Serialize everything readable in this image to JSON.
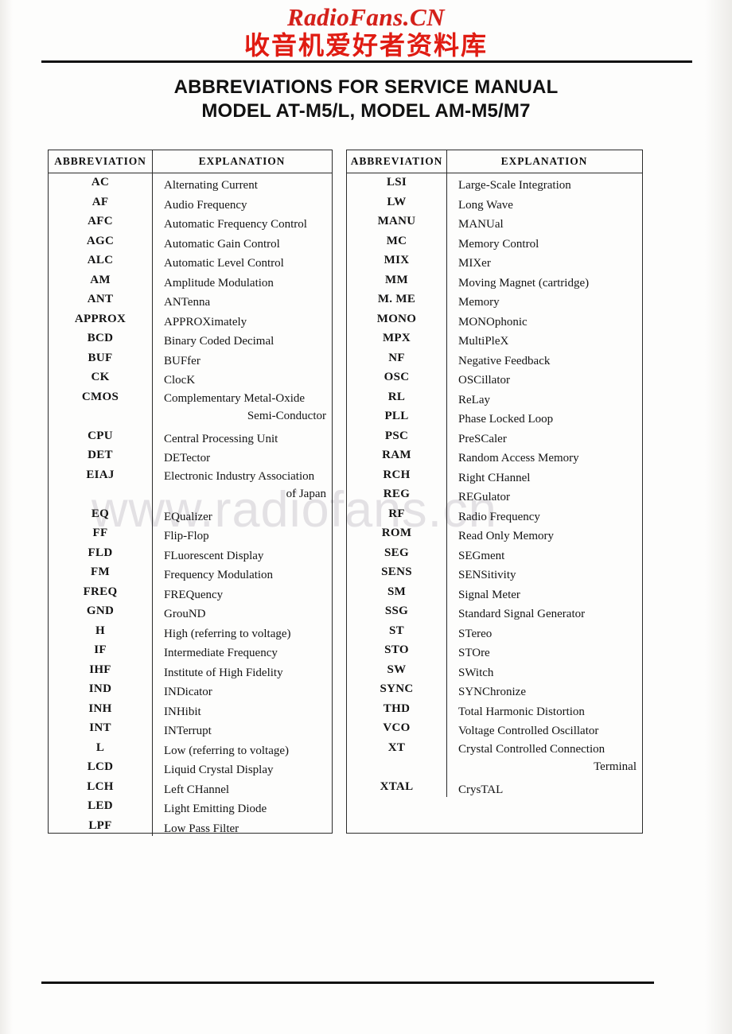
{
  "branding": {
    "latin": "RadioFans.CN",
    "cjk": "收音机爱好者资料库",
    "color": "#d4201a"
  },
  "title": {
    "line1": "ABBREVIATIONS FOR SERVICE MANUAL",
    "line2": "MODEL AT-M5/L, MODEL AM-M5/M7"
  },
  "watermark": {
    "text": "www.radiofans.cn",
    "color": "#e3e1e4"
  },
  "table_left": {
    "headers": {
      "abbreviation": "ABBREVIATION",
      "explanation": "EXPLANATION"
    },
    "rows": [
      {
        "abbr": "AC",
        "exp": "Alternating Current"
      },
      {
        "abbr": "AF",
        "exp": "Audio Frequency"
      },
      {
        "abbr": "AFC",
        "exp": "Automatic Frequency Control"
      },
      {
        "abbr": "AGC",
        "exp": "Automatic Gain Control"
      },
      {
        "abbr": "ALC",
        "exp": "Automatic Level Control"
      },
      {
        "abbr": "AM",
        "exp": "Amplitude Modulation"
      },
      {
        "abbr": "ANT",
        "exp": "ANTenna"
      },
      {
        "abbr": "APPROX",
        "exp": "APPROXimately"
      },
      {
        "abbr": "BCD",
        "exp": "Binary Coded Decimal"
      },
      {
        "abbr": "BUF",
        "exp": "BUFfer"
      },
      {
        "abbr": "CK",
        "exp": "ClocK"
      },
      {
        "abbr": "CMOS",
        "exp": "Complementary Metal-Oxide",
        "exp2": "Semi-Conductor"
      },
      {
        "abbr": "CPU",
        "exp": "Central Processing Unit"
      },
      {
        "abbr": "DET",
        "exp": "DETector"
      },
      {
        "abbr": "EIAJ",
        "exp": "Electronic Industry Association",
        "exp2": "of Japan"
      },
      {
        "abbr": "EQ",
        "exp": "EQualizer"
      },
      {
        "abbr": "FF",
        "exp": "Flip-Flop"
      },
      {
        "abbr": "FLD",
        "exp": "FLuorescent Display"
      },
      {
        "abbr": "FM",
        "exp": "Frequency Modulation"
      },
      {
        "abbr": "FREQ",
        "exp": "FREQuency"
      },
      {
        "abbr": "GND",
        "exp": "GrouND"
      },
      {
        "abbr": "H",
        "exp": "High (referring to voltage)"
      },
      {
        "abbr": "IF",
        "exp": "Intermediate Frequency"
      },
      {
        "abbr": "IHF",
        "exp": "Institute of High Fidelity"
      },
      {
        "abbr": "IND",
        "exp": "INDicator"
      },
      {
        "abbr": "INH",
        "exp": "INHibit"
      },
      {
        "abbr": "INT",
        "exp": "INTerrupt"
      },
      {
        "abbr": "L",
        "exp": "Low (referring to voltage)"
      },
      {
        "abbr": "LCD",
        "exp": "Liquid Crystal Display"
      },
      {
        "abbr": "LCH",
        "exp": "Left CHannel"
      },
      {
        "abbr": "LED",
        "exp": "Light Emitting Diode"
      },
      {
        "abbr": "LPF",
        "exp": "Low Pass Filter"
      }
    ]
  },
  "table_right": {
    "headers": {
      "abbreviation": "ABBREVIATION",
      "explanation": "EXPLANATION"
    },
    "rows": [
      {
        "abbr": "LSI",
        "exp": "Large-Scale Integration"
      },
      {
        "abbr": "LW",
        "exp": "Long Wave"
      },
      {
        "abbr": "MANU",
        "exp": "MANUal"
      },
      {
        "abbr": "MC",
        "exp": "Memory Control"
      },
      {
        "abbr": "MIX",
        "exp": "MIXer"
      },
      {
        "abbr": "MM",
        "exp": "Moving Magnet (cartridge)"
      },
      {
        "abbr": "M. ME",
        "exp": "Memory"
      },
      {
        "abbr": "MONO",
        "exp": "MONOphonic"
      },
      {
        "abbr": "MPX",
        "exp": "MultiPleX"
      },
      {
        "abbr": "NF",
        "exp": "Negative Feedback"
      },
      {
        "abbr": "OSC",
        "exp": "OSCillator"
      },
      {
        "abbr": "RL",
        "exp": "ReLay"
      },
      {
        "abbr": "PLL",
        "exp": "Phase Locked Loop"
      },
      {
        "abbr": "PSC",
        "exp": "PreSCaler"
      },
      {
        "abbr": "RAM",
        "exp": "Random Access Memory"
      },
      {
        "abbr": "RCH",
        "exp": "Right CHannel"
      },
      {
        "abbr": "REG",
        "exp": "REGulator"
      },
      {
        "abbr": "RF",
        "exp": "Radio Frequency"
      },
      {
        "abbr": "ROM",
        "exp": "Read Only Memory"
      },
      {
        "abbr": "SEG",
        "exp": "SEGment"
      },
      {
        "abbr": "SENS",
        "exp": "SENSitivity"
      },
      {
        "abbr": "SM",
        "exp": "Signal Meter"
      },
      {
        "abbr": "SSG",
        "exp": "Standard Signal Generator"
      },
      {
        "abbr": "ST",
        "exp": "STereo"
      },
      {
        "abbr": "STO",
        "exp": "STOre"
      },
      {
        "abbr": "SW",
        "exp": "SWitch"
      },
      {
        "abbr": "SYNC",
        "exp": "SYNChronize"
      },
      {
        "abbr": "THD",
        "exp": "Total Harmonic Distortion"
      },
      {
        "abbr": "VCO",
        "exp": "Voltage Controlled Oscillator"
      },
      {
        "abbr": "XT",
        "exp": "Crystal Controlled Connection",
        "exp2": "Terminal"
      },
      {
        "abbr": "XTAL",
        "exp": "CrysTAL"
      }
    ]
  }
}
